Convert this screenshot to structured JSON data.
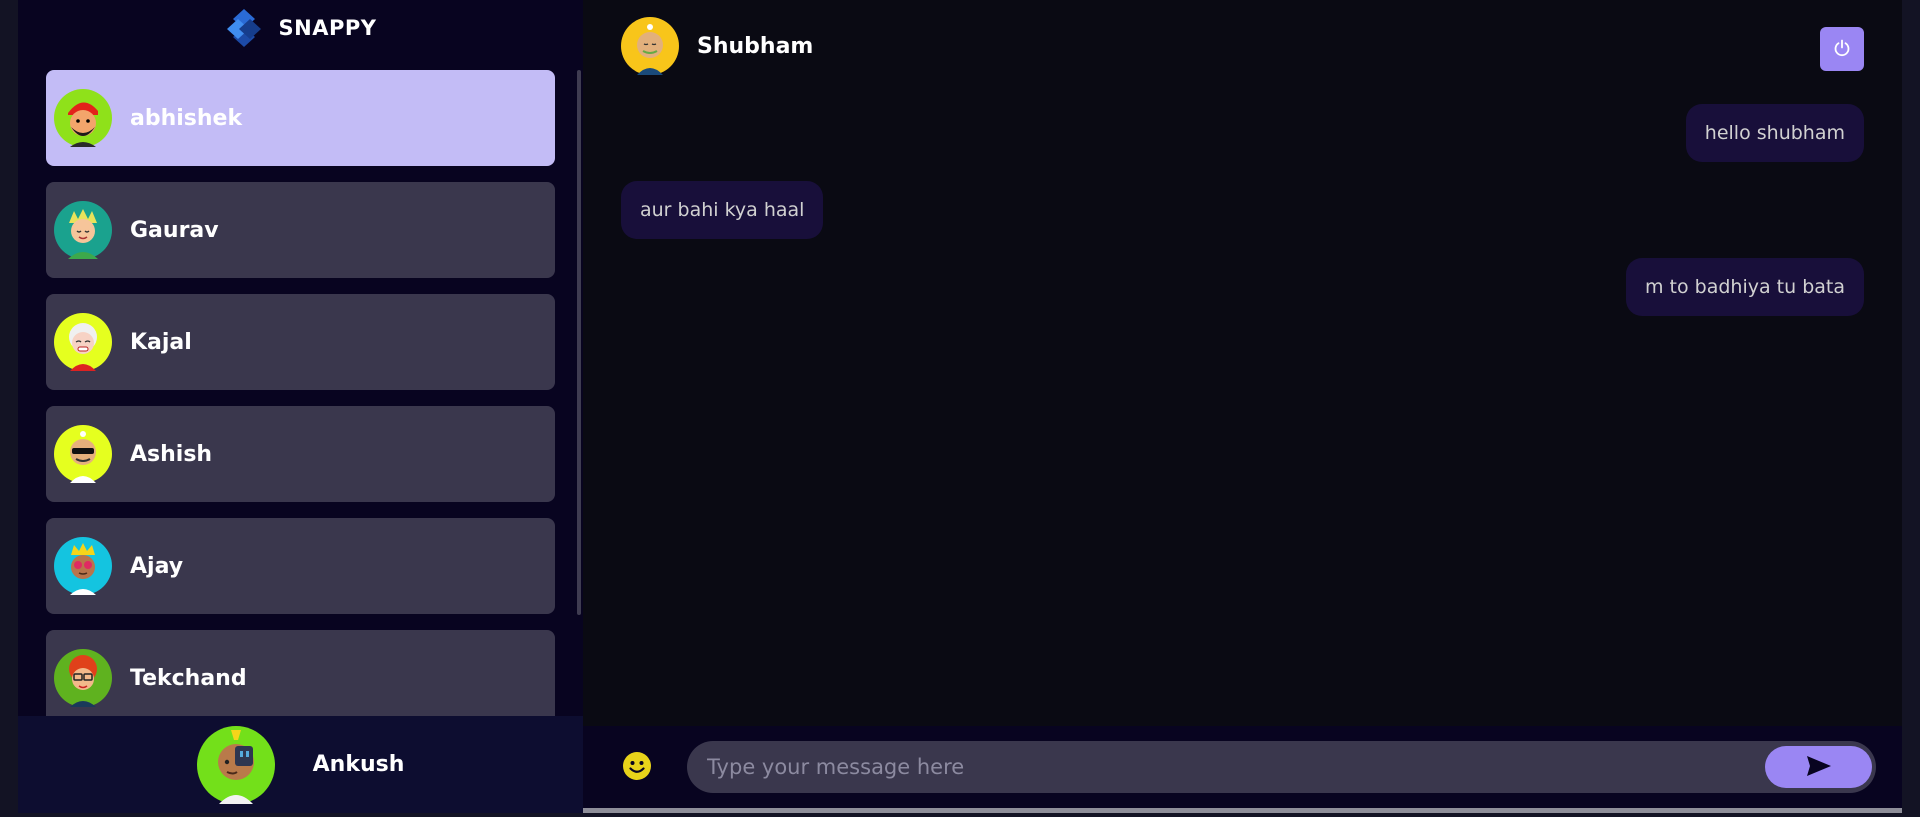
{
  "brand": {
    "title": "SNAPPY",
    "logo_icon": "snappy-logo-icon"
  },
  "contacts": [
    {
      "name": "abhishek",
      "selected": true,
      "avatar": "avatar-red-turban"
    },
    {
      "name": "Gaurav",
      "selected": false,
      "avatar": "avatar-blonde-boy"
    },
    {
      "name": "Kajal",
      "selected": false,
      "avatar": "avatar-white-hair"
    },
    {
      "name": "Ashish",
      "selected": false,
      "avatar": "avatar-sunglasses"
    },
    {
      "name": "Ajay",
      "selected": false,
      "avatar": "avatar-red-glasses"
    },
    {
      "name": "Tekchand",
      "selected": false,
      "avatar": "avatar-red-hair-glasses"
    }
  ],
  "current_user": {
    "name": "Ankush",
    "avatar": "avatar-robot-eye"
  },
  "chat": {
    "contact_name": "Shubham",
    "contact_avatar": "avatar-bald-mustache",
    "messages": [
      {
        "text": "hello shubham",
        "direction": "sent"
      },
      {
        "text": "aur bahi kya haal",
        "direction": "received"
      },
      {
        "text": "m to badhiya tu bata",
        "direction": "sent"
      }
    ],
    "input": {
      "value": "",
      "placeholder": "Type your message here"
    }
  },
  "colors": {
    "accent": "#9a86f3",
    "selected_contact": "#c3bcf6",
    "contact_bg": "#3c3a50",
    "sidebar_bg": "#080420",
    "bubble_bg": "#180f3a"
  }
}
